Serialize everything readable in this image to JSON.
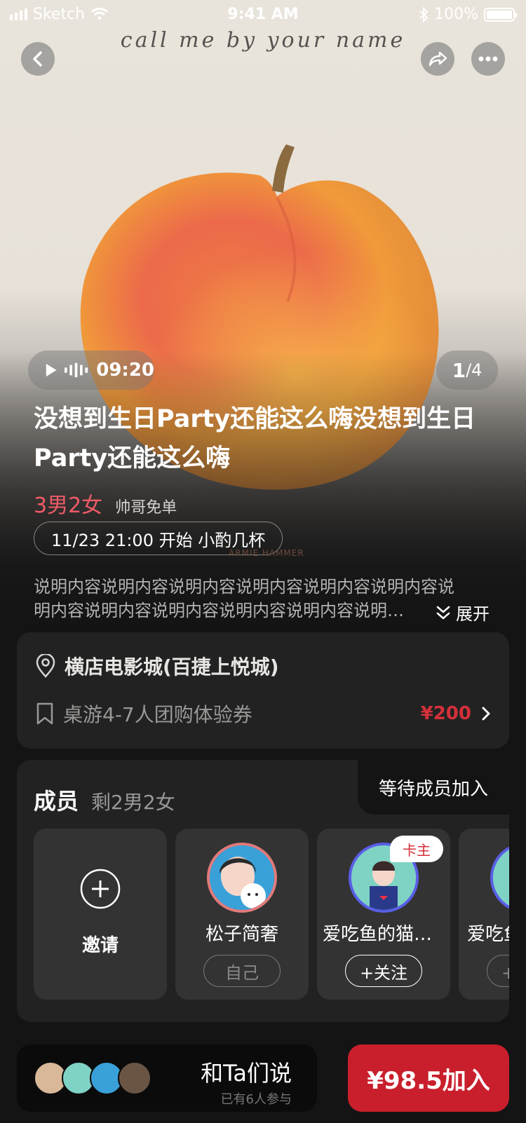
{
  "status_bar": {
    "carrier": "Sketch",
    "time": "9:41 AM",
    "battery": "100%"
  },
  "hero": {
    "script_title": "call me by your name",
    "audio_duration": "09:20",
    "pager_current": "1",
    "pager_total": "/4",
    "caption_small": "ARMIE HAMMER"
  },
  "event": {
    "title": "没想到生日Party还能这么嗨没想到生日Party还能这么嗨",
    "gender": "3男2女",
    "tag": "帅哥免单",
    "time_pill": "11/23 21:00 开始  小酌几杯",
    "desc_line1": "说明内容说明内容说明内容说明内容说明内容说明内容说",
    "desc_line2": "明内容说明内容说明内容说明内容说明内容说明内容说明内容",
    "expand_label": "展开"
  },
  "location": {
    "place": "横店电影城(百捷上悦城)",
    "voucher": "桌游4-7人团购体验券",
    "price": "¥200"
  },
  "members": {
    "title": "成员",
    "remaining": "剩2男2女",
    "waiting": "等待成员加入",
    "invite_label": "邀请",
    "list": [
      {
        "name": "松子简奢",
        "button": "自己"
      },
      {
        "name": "爱吃鱼的猫咪咪",
        "button": "+关注",
        "badge": "卡主"
      },
      {
        "name": "爱吃鱼的猫",
        "button": "+关注"
      }
    ]
  },
  "bottom": {
    "talk_label": "和Ta们说",
    "participants": "已有6人参与",
    "join_label": "¥98.5加入"
  },
  "colors": {
    "accent_red": "#c91f2c",
    "gender_pink": "#ee5b67",
    "price_red": "#d5303b"
  }
}
